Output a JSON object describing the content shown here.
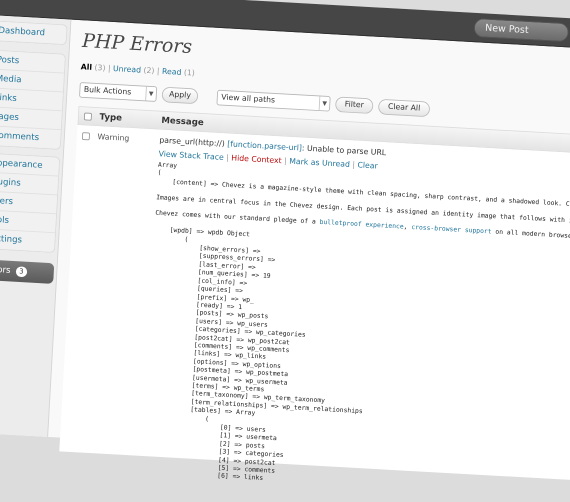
{
  "topbar": {
    "new_post": "New Post"
  },
  "sidebar": {
    "group1": [
      "Dashboard"
    ],
    "group2": [
      "Posts",
      "Media",
      "Links",
      "Pages",
      "Comments"
    ],
    "group3": [
      "Appearance",
      "Plugins",
      "Users",
      "Tools",
      "Settings"
    ],
    "errors": {
      "label": "Errors",
      "count": "3"
    }
  },
  "page": {
    "title": "PHP Errors"
  },
  "filters": {
    "all": "All",
    "all_count": "(3)",
    "sep1": "|",
    "unread": "Unread",
    "unread_count": "(2)",
    "sep2": "|",
    "read": "Read",
    "read_count": "(1)"
  },
  "toolbar": {
    "bulk_actions": "Bulk Actions",
    "apply": "Apply",
    "paths": "View all paths",
    "filter": "Filter",
    "clear_all": "Clear All"
  },
  "table": {
    "col_type": "Type",
    "col_message": "Message"
  },
  "row": {
    "type": "Warning",
    "msg_prefix": "parse_url(http://)",
    "msg_link": "[function.parse-url]",
    "msg_suffix": ": Unable to parse URL",
    "view_stack_trace": "View Stack Trace",
    "hide_context": "Hide Context",
    "mark_as_unread": "Mark as Unread",
    "clear": "Clear",
    "sep": "|"
  },
  "dump": {
    "lines": [
      "Array",
      "(",
      "    [content] => Chevez is a magazine-style theme with clean spacing, sharp contrast, and a shadowed look. Content is",
      "",
      "Images are in central focus in the Chevez design. Each post is assigned an identity image that follows with it throu",
      "",
      "Chevez comes with our standard pledge of a ",
      "",
      "    [wpdb] => wpdb Object",
      "        (",
      "            [show_errors] =>",
      "            [suppress_errors] =>",
      "            [last_error] =>",
      "            [num_queries] => 19",
      "            [col_info] =>",
      "            [queries] =>",
      "            [prefix] => wp_",
      "            [ready] => 1",
      "            [posts] => wp_posts",
      "            [users] => wp_users",
      "            [categories] => wp_categories",
      "            [post2cat] => wp_post2cat",
      "            [comments] => wp_comments",
      "            [links] => wp_links",
      "            [options] => wp_options",
      "            [postmeta] => wp_postmeta",
      "            [usermeta] => wp_usermeta",
      "            [terms] => wp_terms",
      "            [term_taxonomy] => wp_term_taxonomy",
      "            [term_relationships] => wp_term_relationships",
      "            [tables] => Array",
      "                (",
      "                    [0] => users",
      "                    [1] => usermeta",
      "                    [2] => posts",
      "                    [3] => categories",
      "                    [4] => post2cat",
      "                    [5] => comments",
      "                    [6] => links"
    ],
    "pledge_link1": "bulletproof experience",
    "pledge_mid": ", ",
    "pledge_link2": "cross-browser support",
    "pledge_end": " on all modern browsers, and "
  }
}
